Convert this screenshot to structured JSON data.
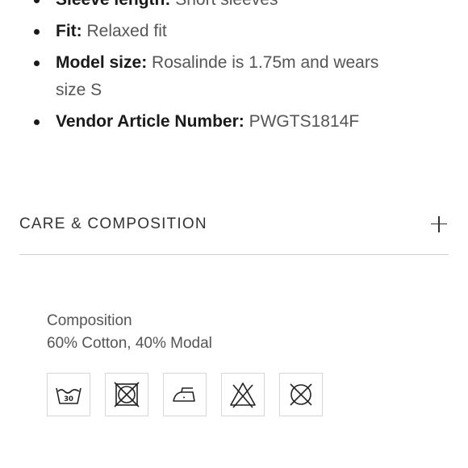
{
  "specs": [
    {
      "key": "Sleeve length:",
      "value": "Short sleeves"
    },
    {
      "key": "Fit:",
      "value": "Relaxed fit"
    },
    {
      "key": "Model size:",
      "value": "Rosalinde is 1.75m and wears size S"
    },
    {
      "key": "Vendor Article Number:",
      "value": "PWGTS1814F"
    }
  ],
  "care_section": {
    "title": "CARE & COMPOSITION",
    "expand_icon": "plus-icon",
    "composition_label": "Composition",
    "composition_value": "60% Cotton, 40% Modal",
    "wash_temperature": "30",
    "care_icons": [
      "wash-30-icon",
      "no-tumble-dry-icon",
      "iron-low-icon",
      "no-bleach-icon",
      "no-dry-clean-icon"
    ]
  }
}
